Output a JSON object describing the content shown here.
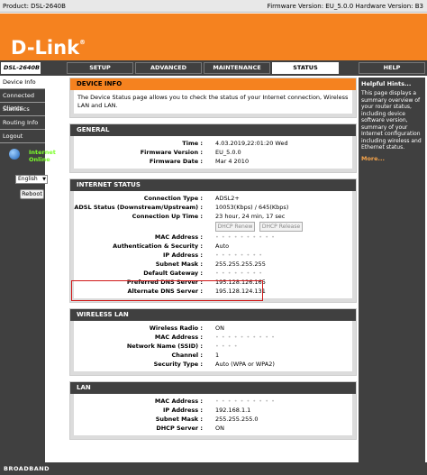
{
  "topbar": {
    "product": "Product: DSL-2640B",
    "firmware": "Firmware Version: EU_5.0.0 Hardware Version: B3"
  },
  "brand": {
    "logo": "D-Link",
    "mark": "®"
  },
  "model": "DSL-2640B",
  "tabs": [
    {
      "label": "SETUP"
    },
    {
      "label": "ADVANCED"
    },
    {
      "label": "MAINTENANCE"
    },
    {
      "label": "STATUS"
    }
  ],
  "help_tab": "HELP",
  "sidebar": {
    "items": [
      {
        "label": "Device Info"
      },
      {
        "label": "Connected Clients"
      },
      {
        "label": "Statistics"
      },
      {
        "label": "Routing Info"
      },
      {
        "label": "Logout"
      }
    ],
    "online_line1": "Internet",
    "online_line2": "Online",
    "language": "English",
    "reboot": "Reboot"
  },
  "device_info": {
    "title": "DEVICE INFO",
    "description": "The Device Status page allows you to check the status of your Internet connection, Wireless LAN and LAN."
  },
  "general": {
    "title": "GENERAL",
    "rows": [
      {
        "k": "Time :",
        "v": "4.03.2019,22:01:20 Wed"
      },
      {
        "k": "Firmware Version :",
        "v": "EU_5.0.0"
      },
      {
        "k": "Firmware Date :",
        "v": "Mar 4 2010"
      }
    ]
  },
  "internet": {
    "title": "INTERNET STATUS",
    "rows_a": [
      {
        "k": "Connection Type :",
        "v": "ADSL2+"
      },
      {
        "k": "ADSL Status (Downstream/Upstream) :",
        "v": "10053(Kbps) / 645(Kbps)"
      },
      {
        "k": "Connection Up Time :",
        "v": "23 hour, 24 min, 17 sec"
      }
    ],
    "dhcp_renew": "DHCP Renew",
    "dhcp_release": "DHCP Release",
    "rows_b": [
      {
        "k": "MAC Address :",
        "v": "• • • • • • • • • •"
      },
      {
        "k": "Authentication & Security :",
        "v": "Auto"
      },
      {
        "k": "IP Address :",
        "v": "• • • • • • • •"
      },
      {
        "k": "Subnet Mask :",
        "v": "255.255.255.255"
      },
      {
        "k": "Default Gateway :",
        "v": "• • • • • • • •"
      },
      {
        "k": "Preferred DNS Server :",
        "v": "195.128.126.165"
      },
      {
        "k": "Alternate DNS Server :",
        "v": "195.128.124.131"
      }
    ]
  },
  "wireless": {
    "title": "WIRELESS LAN",
    "rows": [
      {
        "k": "Wireless Radio :",
        "v": "ON"
      },
      {
        "k": "MAC Address :",
        "v": "• • • • • • • • • •"
      },
      {
        "k": "Network Name (SSID) :",
        "v": "• • • •"
      },
      {
        "k": "Channel :",
        "v": "1"
      },
      {
        "k": "Security Type :",
        "v": "Auto (WPA or WPA2)"
      }
    ]
  },
  "lan": {
    "title": "LAN",
    "rows": [
      {
        "k": "MAC Address :",
        "v": "• • • • • • • • • •"
      },
      {
        "k": "IP Address :",
        "v": "192.168.1.1"
      },
      {
        "k": "Subnet Mask :",
        "v": "255.255.255.0"
      },
      {
        "k": "DHCP Server :",
        "v": "ON"
      }
    ]
  },
  "help": {
    "title": "Helpful Hints...",
    "text": "This page displays a summary overview of your router status, including device software version, summary of your Internet configuration including wireless and Ethernet status.",
    "more": "More..."
  },
  "footer": "BROADBAND",
  "colors": {
    "accent": "#f5821f",
    "dark": "#404040",
    "highlight_border": "#d01818",
    "online": "#7cff2b"
  }
}
